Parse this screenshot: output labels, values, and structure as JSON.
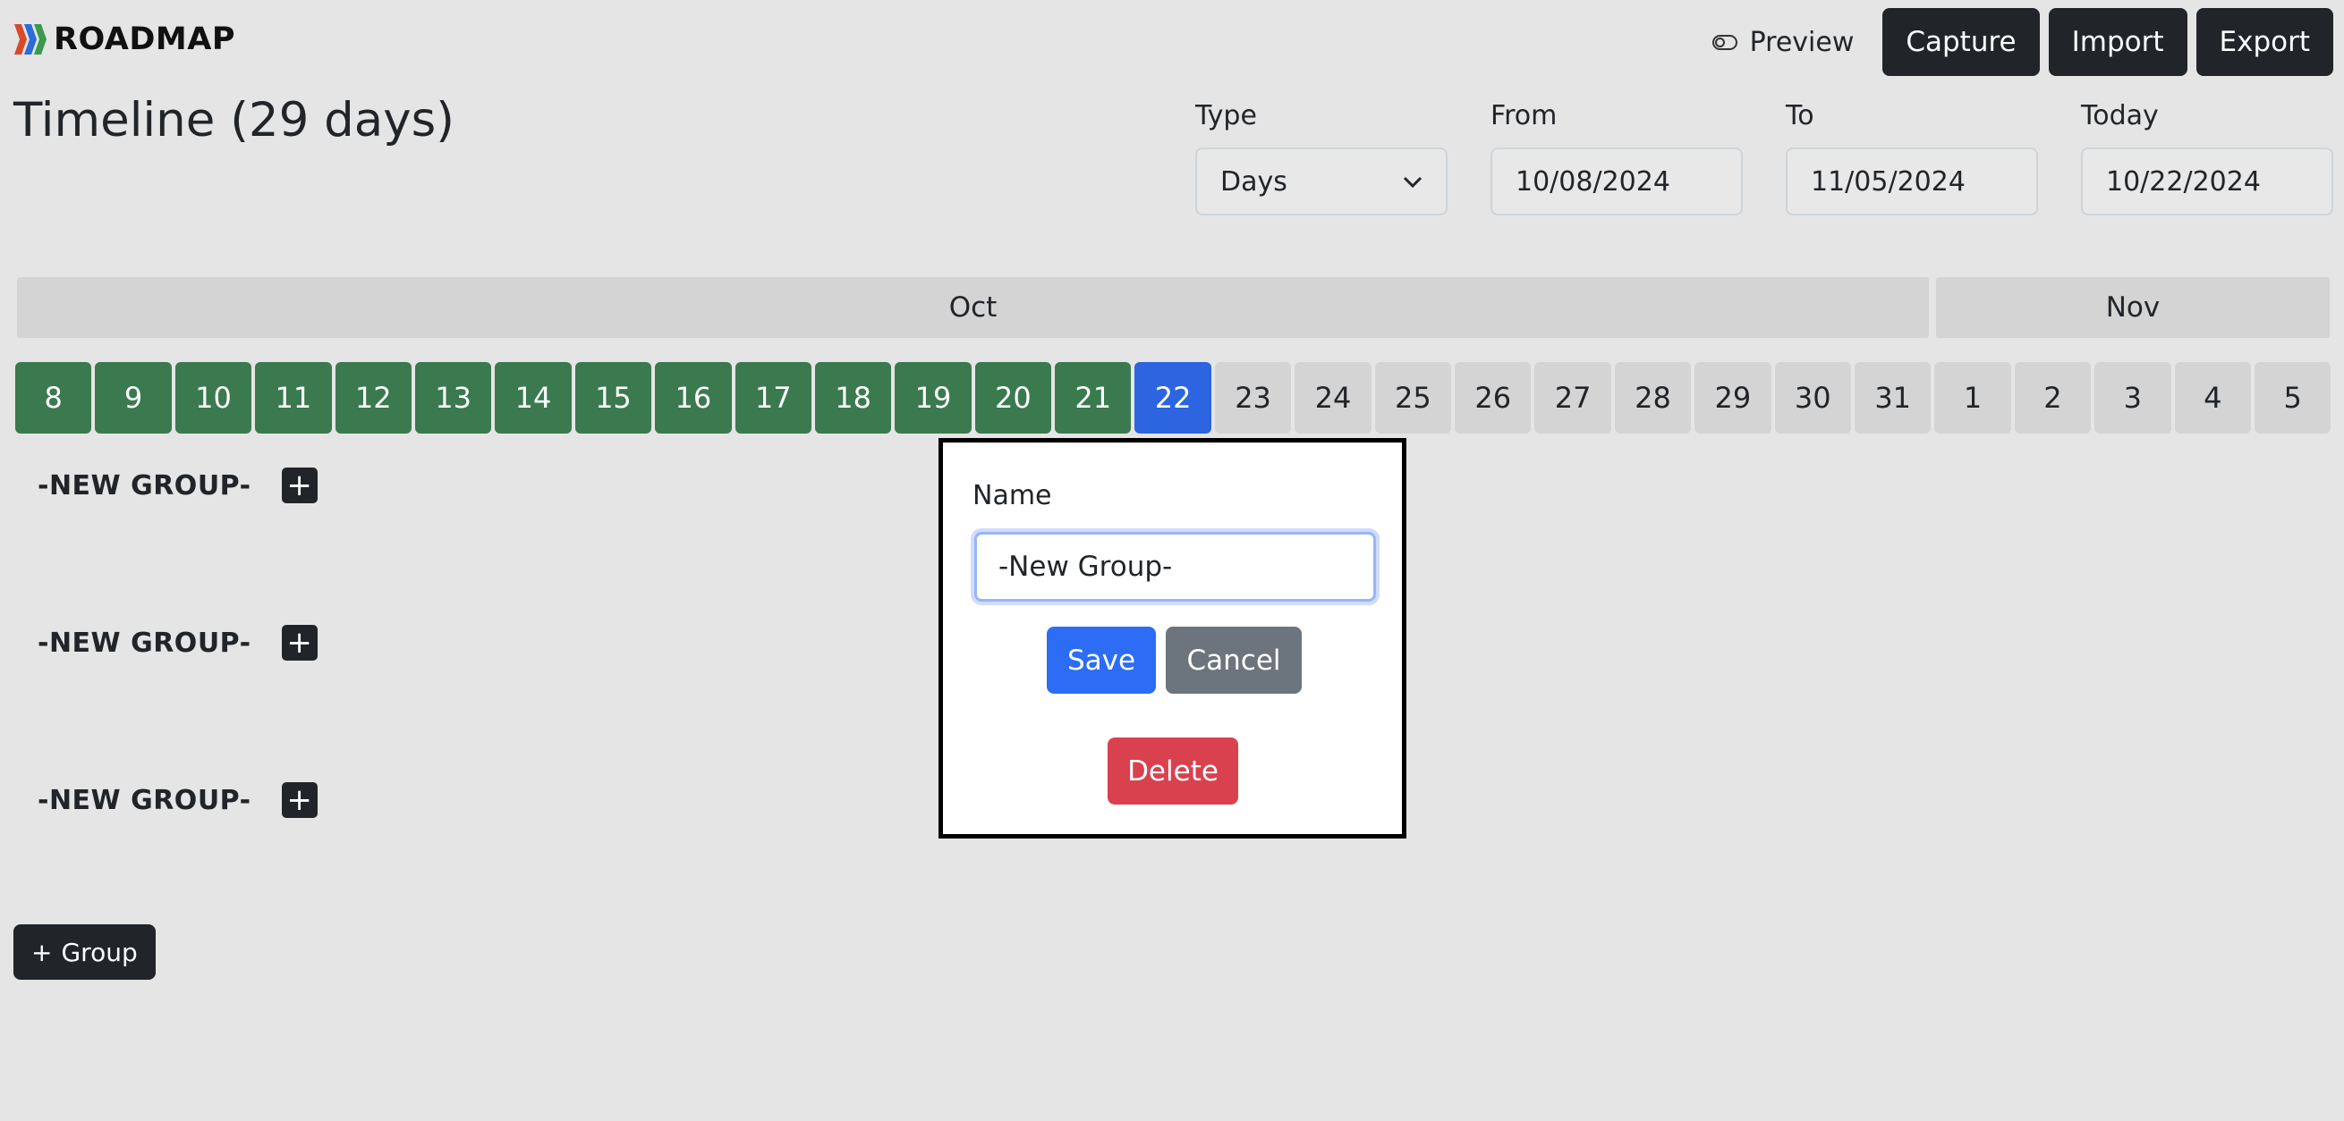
{
  "app": {
    "name": "ROADMAP",
    "logo_colors": [
      "#d94a2b",
      "#2b6cd9",
      "#3a9a4e"
    ]
  },
  "header": {
    "preview_label": "Preview",
    "capture_label": "Capture",
    "import_label": "Import",
    "export_label": "Export"
  },
  "page": {
    "title": "Timeline (29 days)"
  },
  "filters": {
    "type": {
      "label": "Type",
      "value": "Days"
    },
    "from": {
      "label": "From",
      "value": "10/08/2024"
    },
    "to": {
      "label": "To",
      "value": "11/05/2024"
    },
    "today": {
      "label": "Today",
      "value": "10/22/2024"
    }
  },
  "timeline": {
    "months": [
      "Oct",
      "Nov"
    ],
    "days": [
      "8",
      "9",
      "10",
      "11",
      "12",
      "13",
      "14",
      "15",
      "16",
      "17",
      "18",
      "19",
      "20",
      "21",
      "22",
      "23",
      "24",
      "25",
      "26",
      "27",
      "28",
      "29",
      "30",
      "31",
      "1",
      "2",
      "3",
      "4",
      "5"
    ],
    "today_index": 14,
    "colors": {
      "past": "#3a7a4e",
      "today": "#2d64e0",
      "future": "#d4d4d4"
    }
  },
  "groups": [
    {
      "name": "-NEW GROUP-"
    },
    {
      "name": "-NEW GROUP-"
    },
    {
      "name": "-NEW GROUP-"
    }
  ],
  "add_group_label": "Group",
  "modal": {
    "name_label": "Name",
    "name_value": "-New Group-",
    "save_label": "Save",
    "cancel_label": "Cancel",
    "delete_label": "Delete"
  }
}
